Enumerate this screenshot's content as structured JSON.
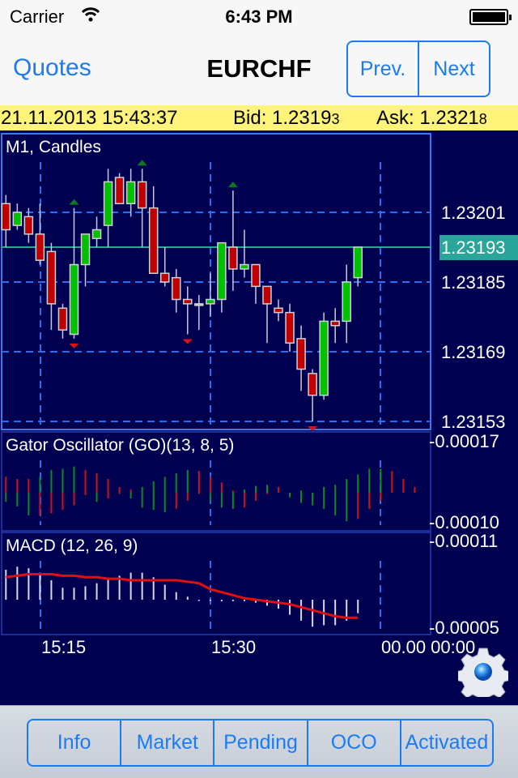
{
  "status_bar": {
    "carrier": "Carrier",
    "time": "6:43 PM"
  },
  "nav": {
    "back_label": "Quotes",
    "title": "EURCHF",
    "prev_label": "Prev.",
    "next_label": "Next"
  },
  "quote": {
    "datetime": "21.11.2013 15:43:37",
    "bid_label": "Bid:",
    "bid_main": "1.2319",
    "bid_pip": "3",
    "ask_label": "Ask:",
    "ask_main": "1.2321",
    "ask_pip": "8"
  },
  "colors": {
    "background": "#000050",
    "accent": "#1a7cf5",
    "bull": "#00c000",
    "bear": "#c00000",
    "grid": "#2a6ef0",
    "current_price": "#2aa59a",
    "quote_bar": "#fff47a"
  },
  "chart_data": [
    {
      "type": "candlestick",
      "title": "M1, Candles",
      "current_price": "1.23193",
      "y_ticks": [
        "1.23201",
        "1.23185",
        "1.23169",
        "1.23153"
      ],
      "ylim": [
        1.2315,
        1.2322
      ],
      "x_ticks": [
        "15:15",
        "15:30",
        "00.00 00:00"
      ],
      "ohlc": [
        [
          1.23203,
          1.23205,
          1.23193,
          1.23197
        ],
        [
          1.23198,
          1.23203,
          1.23197,
          1.23201
        ],
        [
          1.232,
          1.23202,
          1.23194,
          1.23196
        ],
        [
          1.23196,
          1.23203,
          1.23189,
          1.2319
        ],
        [
          1.23192,
          1.23194,
          1.23174,
          1.2318
        ],
        [
          1.23179,
          1.2318,
          1.23172,
          1.23174
        ],
        [
          1.23173,
          1.23202,
          1.23172,
          1.23189
        ],
        [
          1.23189,
          1.23196,
          1.23184,
          1.23196
        ],
        [
          1.23195,
          1.232,
          1.23193,
          1.23197
        ],
        [
          1.23198,
          1.23211,
          1.23193,
          1.23208
        ],
        [
          1.23209,
          1.2321,
          1.23203,
          1.23203
        ],
        [
          1.23203,
          1.23211,
          1.232,
          1.23208
        ],
        [
          1.23208,
          1.23211,
          1.23193,
          1.23202
        ],
        [
          1.23202,
          1.23207,
          1.23187,
          1.23187
        ],
        [
          1.23187,
          1.23193,
          1.23184,
          1.23185
        ],
        [
          1.23186,
          1.23188,
          1.23178,
          1.23181
        ],
        [
          1.23181,
          1.23184,
          1.23173,
          1.2318
        ],
        [
          1.2318,
          1.23182,
          1.23174,
          1.2318
        ],
        [
          1.2318,
          1.23187,
          1.23177,
          1.23181
        ],
        [
          1.23181,
          1.23194,
          1.23178,
          1.23194
        ],
        [
          1.23193,
          1.23206,
          1.23183,
          1.23188
        ],
        [
          1.23188,
          1.23197,
          1.23186,
          1.23189
        ],
        [
          1.23189,
          1.23189,
          1.2318,
          1.23184
        ],
        [
          1.23184,
          1.23184,
          1.23171,
          1.2318
        ],
        [
          1.23179,
          1.23181,
          1.23176,
          1.23178
        ],
        [
          1.23178,
          1.2318,
          1.23169,
          1.23171
        ],
        [
          1.23172,
          1.23175,
          1.2316,
          1.23165
        ],
        [
          1.23164,
          1.23165,
          1.23153,
          1.23159
        ],
        [
          1.23159,
          1.23178,
          1.23158,
          1.23176
        ],
        [
          1.23176,
          1.23179,
          1.23171,
          1.23175
        ],
        [
          1.23176,
          1.23189,
          1.23171,
          1.23185
        ],
        [
          1.23186,
          1.23193,
          1.23184,
          1.23193
        ]
      ],
      "fractals_up": [
        6,
        12,
        20
      ],
      "fractals_down": [
        6,
        16,
        27
      ]
    },
    {
      "type": "bar",
      "title": "Gator Oscillator (GO)(13, 8, 5)",
      "y_ticks": [
        "-0.00017",
        "-0.00010"
      ],
      "upper": [
        1.4e-05,
        1.2e-05,
        1.2e-05,
        1.4e-05,
        2e-05,
        2.1e-05,
        2.3e-05,
        2e-05,
        1.7e-05,
        1.2e-05,
        5e-06,
        3e-06,
        5e-06,
        1e-05,
        1.4e-05,
        1.7e-05,
        2e-05,
        1.9e-05,
        1.4e-05,
        9e-06,
        2e-06,
        3e-06,
        6e-06,
        7e-06,
        5e-06,
        0,
        2e-06,
        0,
        5e-06,
        7e-06,
        1.2e-05,
        1.6e-05,
        2.1e-05,
        2.1e-05,
        1.9e-05,
        1.2e-05,
        5e-06
      ],
      "upper_colors": "RRRGGGGRRRRRGGGGGRRRRGGGRGGGGGGGGGRRR",
      "lower": [
        -8e-06,
        -1.2e-05,
        -2e-05,
        -2e-05,
        -1.8e-05,
        -1.5e-05,
        -1.1e-05,
        -2e-06,
        -8e-06,
        -5e-06,
        -1e-06,
        -5e-06,
        -1.3e-05,
        -1.5e-05,
        -1.7e-05,
        -1.4e-05,
        -7e-06,
        -1e-06,
        -7e-06,
        -1.3e-05,
        -1.4e-05,
        -1.3e-05,
        -7e-06,
        -1e-06,
        0,
        -4e-06,
        -9e-06,
        -1.1e-05,
        -1.4e-05,
        -2e-05,
        -2.5e-05,
        -2.3e-05,
        -1.4e-05,
        -7e-06,
        0,
        0,
        0
      ],
      "lower_colors": "GGGRRRRRGRRGGGGRRRGGGRRRRGGGGGGRRRGGG"
    },
    {
      "type": "bar+line",
      "title": "MACD (12, 26, 9)",
      "y_ticks": [
        "-0.00011",
        "-0.00005"
      ],
      "histogram": [
        2e-05,
        2.2e-05,
        2.1e-05,
        1.8e-05,
        1.3e-05,
        8e-06,
        8e-06,
        9e-06,
        1.1e-05,
        1.4e-05,
        1.6e-05,
        1.8e-05,
        1.8e-05,
        1.5e-05,
        1e-05,
        5e-06,
        2e-06,
        0,
        0,
        -1e-06,
        -1e-06,
        -1e-06,
        -2e-06,
        -4e-06,
        -6e-06,
        -1e-05,
        -1.4e-05,
        -1.8e-05,
        -1.7e-05,
        -1.7e-05,
        -1.4e-05,
        -9e-06
      ],
      "signal": [
        1.5e-05,
        1.6e-05,
        1.7e-05,
        1.7e-05,
        1.7e-05,
        1.6e-05,
        1.6e-05,
        1.5e-05,
        1.5e-05,
        1.4e-05,
        1.4e-05,
        1.3e-05,
        1.3e-05,
        1.3e-05,
        1.3e-05,
        1.3e-05,
        1.2e-05,
        1.1e-05,
        7e-06,
        5e-06,
        3e-06,
        1e-06,
        0,
        -1e-06,
        -2e-06,
        -3e-06,
        -5e-06,
        -7e-06,
        -9e-06,
        -1.1e-05,
        -1.2e-05,
        -1.2e-05
      ]
    }
  ],
  "toolbar": {
    "tabs": [
      "Info",
      "Market",
      "Pending",
      "OCO",
      "Activated"
    ]
  }
}
